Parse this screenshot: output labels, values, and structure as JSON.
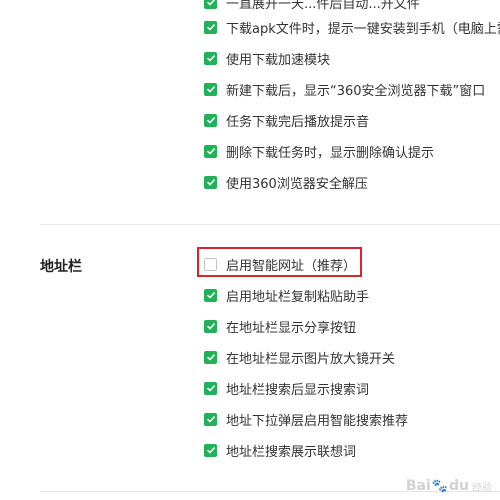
{
  "colors": {
    "checked": "#20b159",
    "highlight": "#d9262d"
  },
  "download_section": {
    "items": [
      {
        "label": "一直展开一天...件后自动...开文件",
        "checked": true,
        "partial": true
      },
      {
        "label": "下载apk文件时，提示一键安装到手机（电脑上需",
        "checked": true
      },
      {
        "label": "使用下载加速模块",
        "checked": true
      },
      {
        "label": "新建下载后，显示“360安全浏览器下载”窗口",
        "checked": true
      },
      {
        "label": "任务下载完后播放提示音",
        "checked": true
      },
      {
        "label": "删除下载任务时，显示删除确认提示",
        "checked": true
      },
      {
        "label": "使用360浏览器安全解压",
        "checked": true
      }
    ]
  },
  "address_section": {
    "title": "地址栏",
    "items": [
      {
        "label": "启用智能网址（推荐）",
        "checked": false,
        "highlighted": true
      },
      {
        "label": "启用地址栏复制粘贴助手",
        "checked": true
      },
      {
        "label": "在地址栏显示分享按钮",
        "checked": true
      },
      {
        "label": "在地址栏显示图片放大镜开关",
        "checked": true
      },
      {
        "label": "地址栏搜索后显示搜索词",
        "checked": true
      },
      {
        "label": "地址下拉弹层启用智能搜索推荐",
        "checked": true
      },
      {
        "label": "地址栏搜索展示联想词",
        "checked": true
      }
    ]
  },
  "watermark": {
    "text_a": "Bai",
    "text_b": "du",
    "paw": "🐾",
    "sub": "经验"
  }
}
